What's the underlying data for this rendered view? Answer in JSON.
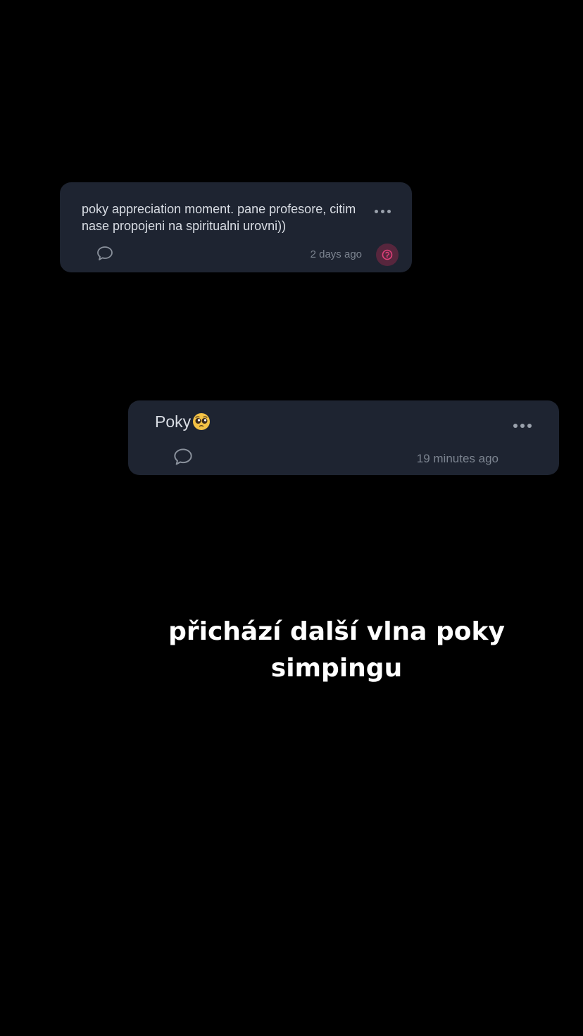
{
  "cards": [
    {
      "text": "poky appreciation moment. pane profesore, citim nase propojeni na spiritualni urovni))",
      "time": "2 days ago",
      "icons": [
        "comment-icon",
        "more-options-icon",
        "avatar-icon"
      ]
    },
    {
      "text": "Poky",
      "emoji": "pleading-face-emoji",
      "time": "19 minutes ago",
      "icons": [
        "comment-icon",
        "more-options-icon"
      ]
    }
  ],
  "caption": "přichází další vlna poky simpingu",
  "colors": {
    "background": "#000000",
    "card": "#1e2431",
    "text": "#d9dde4",
    "muted": "#7c8490",
    "avatar": "#57263d",
    "avatar_accent": "#e0407a"
  }
}
